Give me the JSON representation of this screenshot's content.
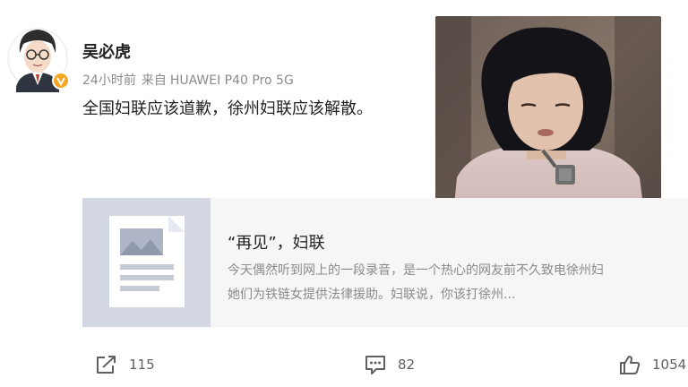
{
  "post": {
    "author": {
      "name": "吴必虎",
      "avatar_icon": "cartoon-man-with-glasses",
      "verified_icon": "verified-v-badge",
      "verified_color": "#f5a623"
    },
    "meta": {
      "time": "24小时前",
      "source_prefix": "来自",
      "source_device": "HUAWEI P40 Pro 5G"
    },
    "text": "全国妇联应该道歉，徐州妇联应该解散。",
    "image_icon": "photo-of-woman-with-chain"
  },
  "article_card": {
    "thumbnail_icon": "document-article-icon",
    "title": "“再见”，妇联",
    "summary_line1": "今天偶然听到网上的一段录音，是一个热心的网友前不久致电徐州妇",
    "summary_line2": "她们为铁链女提供法律援助。妇联说，你该打徐州..."
  },
  "actions": {
    "share": {
      "icon": "share-icon",
      "count": "115"
    },
    "comment": {
      "icon": "comment-icon",
      "count": "82"
    },
    "like": {
      "icon": "thumbs-up-icon",
      "count": "1054"
    }
  }
}
